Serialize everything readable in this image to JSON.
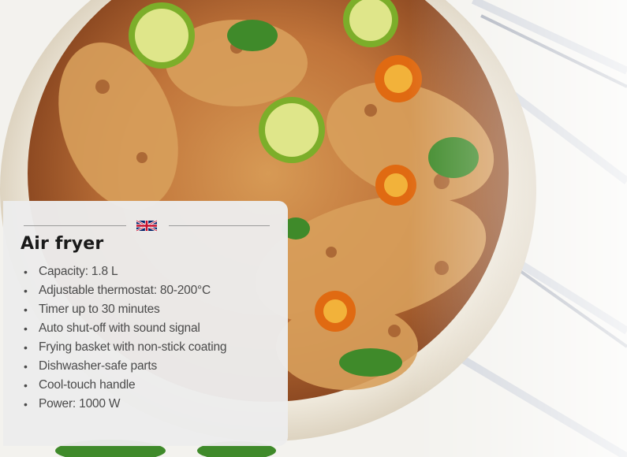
{
  "product": {
    "title": "Air fryer",
    "language_icon": "uk-flag-icon",
    "features": [
      "Capacity: 1.8 L",
      "Adjustable thermostat: 80-200°C",
      "Timer up to 30 minutes",
      "Auto shut-off with sound signal",
      "Frying basket with non-stick coating",
      "Dishwasher-safe parts",
      "Cool-touch handle",
      "Power: 1000 W"
    ]
  },
  "colors": {
    "accent_bar": "#c8332a",
    "card_background": "#ececec",
    "title_text": "#1a1a1a",
    "body_text": "#4a4a4a"
  }
}
